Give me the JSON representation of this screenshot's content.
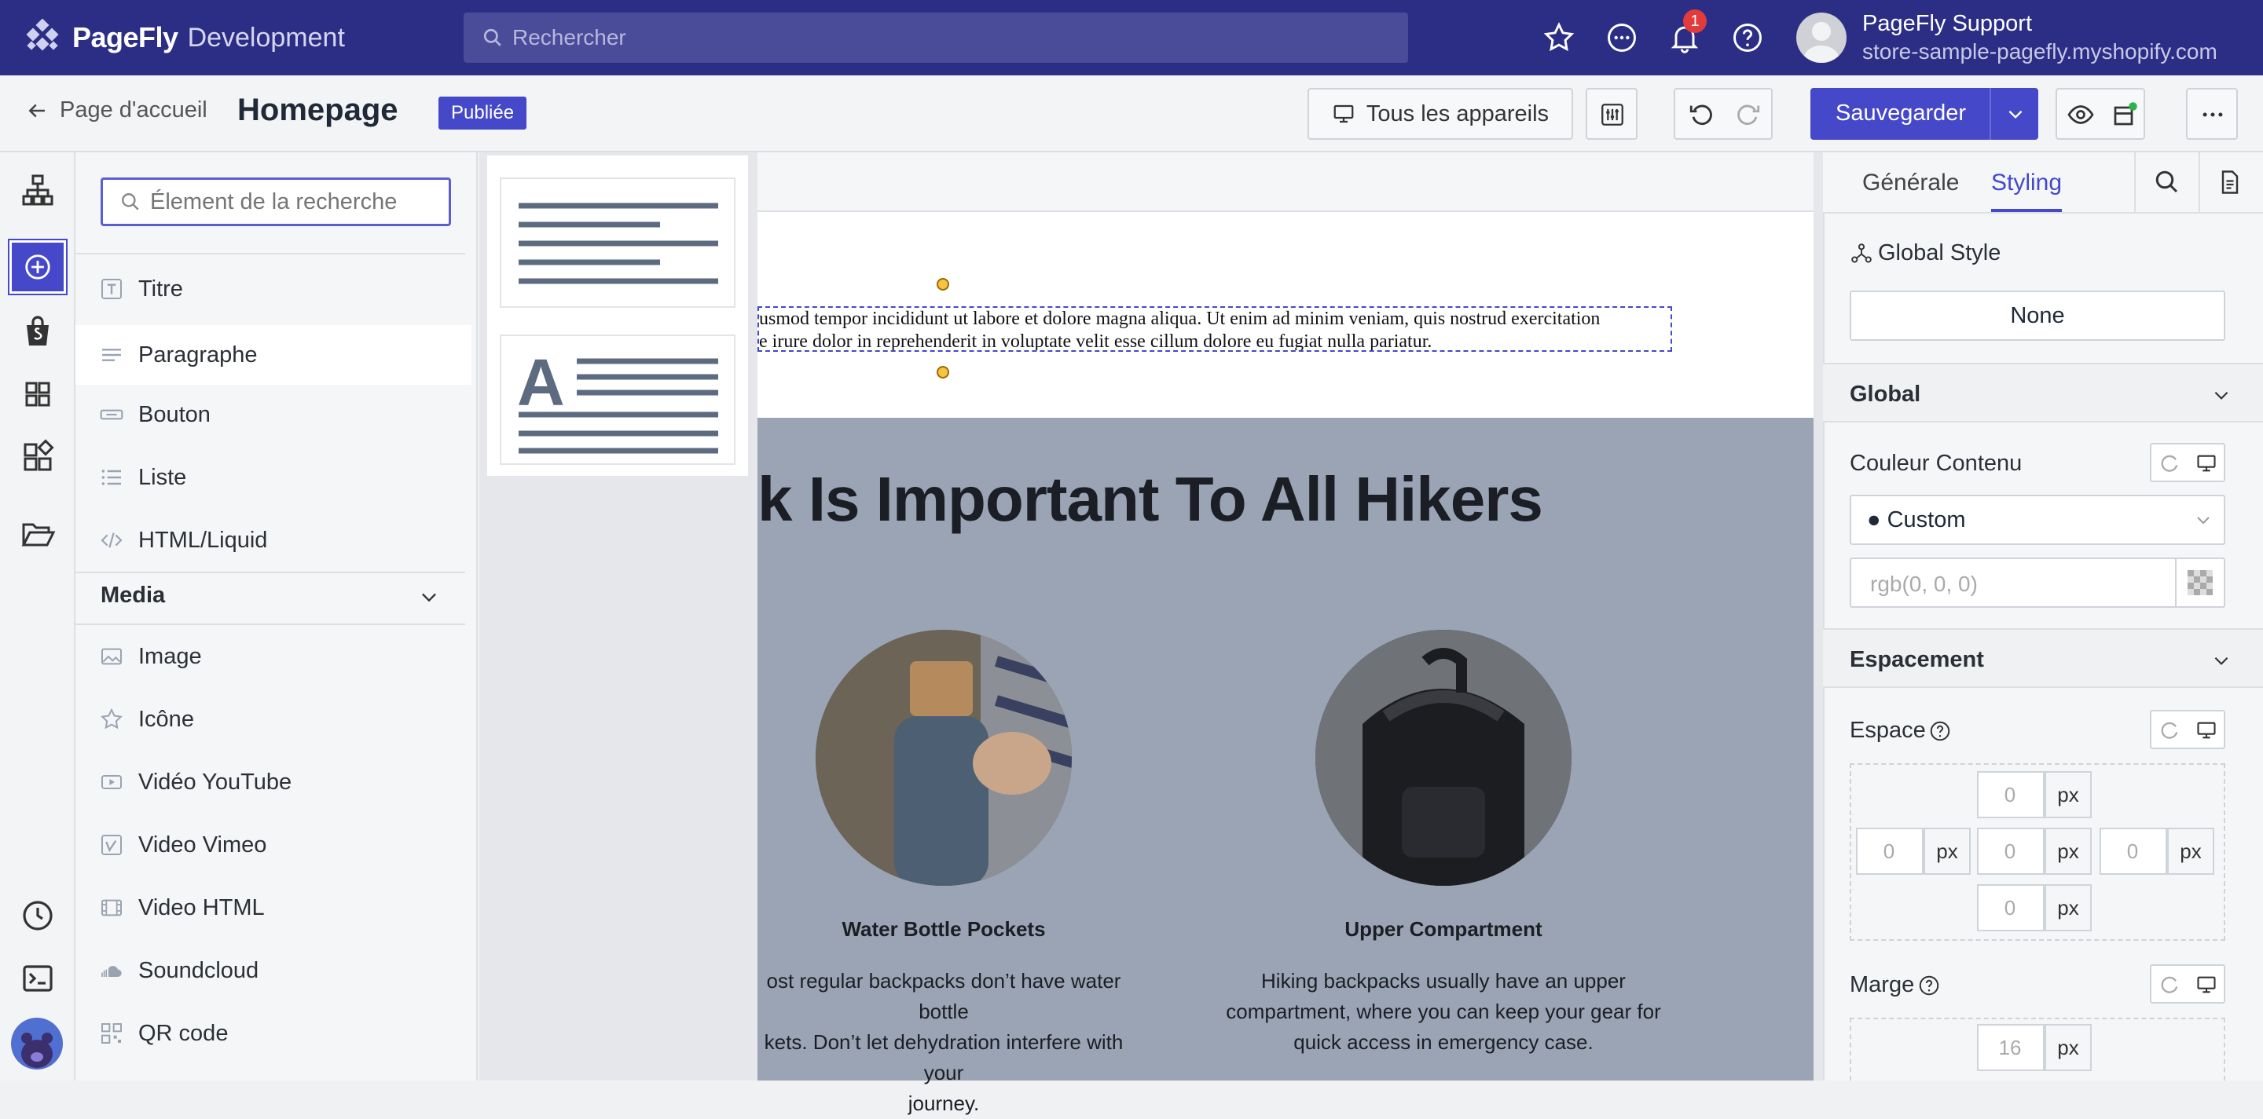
{
  "topbar": {
    "brand": "PageFly",
    "env": "Development",
    "search_placeholder": "Rechercher",
    "notification_count": "1",
    "user_name": "PageFly Support",
    "user_store": "store-sample-pagefly.myshopify.com"
  },
  "subbar": {
    "back_label": "Page d'accueil",
    "page_title": "Homepage",
    "status": "Publiée",
    "devices_label": "Tous les appareils",
    "save_label": "Sauvegarder"
  },
  "elements_panel": {
    "search_placeholder": "Élement de la recherche",
    "basic_items": [
      "Titre",
      "Paragraphe",
      "Bouton",
      "Liste",
      "HTML/Liquid"
    ],
    "media_section": "Media",
    "media_items": [
      "Image",
      "Icône",
      "Vidéo YouTube",
      "Video Vimeo",
      "Video HTML",
      "Soundcloud",
      "QR code"
    ],
    "selected": "Paragraphe"
  },
  "canvas": {
    "lorem_line1": "usmod tempor incididunt ut labore et dolore magna aliqua. Ut enim ad minim veniam, quis nostrud exercitation",
    "lorem_line2": "e irure dolor in reprehenderit in voluptate velit esse cillum dolore eu fugiat nulla pariatur.",
    "hero_title": "k Is Important To All Hikers",
    "feature1_title": "Water Bottle Pockets",
    "feature1_desc": [
      "ost regular backpacks don’t have water bottle",
      "kets. Don’t let dehydration interfere with your",
      "journey."
    ],
    "feature2_title": "Upper Compartment",
    "feature2_desc": [
      "Hiking backpacks usually have an upper",
      "compartment, where you can keep your gear for",
      "quick access in emergency case."
    ]
  },
  "right_panel": {
    "tab_general": "Générale",
    "tab_styling": "Styling",
    "global_style_label": "Global Style",
    "global_style_value": "None",
    "section_global": "Global",
    "content_color_label": "Couleur Contenu",
    "color_mode": "● Custom",
    "color_placeholder": "rgb(0, 0, 0)",
    "section_spacing": "Espacement",
    "spacing_label": "Espace",
    "padding_values": [
      "0",
      "0",
      "0",
      "0",
      "0"
    ],
    "unit": "px",
    "margin_label": "Marge",
    "margin_value": "16"
  },
  "colors": {
    "topbar": "#2c2e86",
    "accent": "#4548c8"
  }
}
